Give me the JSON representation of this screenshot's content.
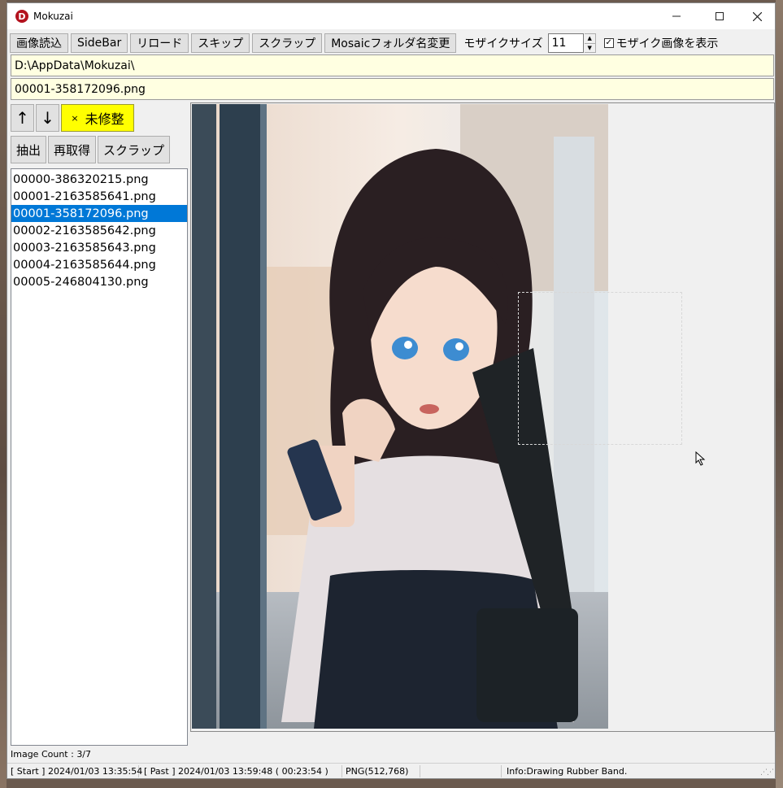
{
  "window": {
    "title": "Mokuzai",
    "icon_letter": "D"
  },
  "toolbar": {
    "load_images": "画像読込",
    "sidebar": "SideBar",
    "reload": "リロード",
    "skip": "スキップ",
    "scrap": "スクラップ",
    "rename_mosaic_folder": "Mosaicフォルダ名変更",
    "mosaic_size_label": "モザイクサイズ",
    "mosaic_size_value": "11",
    "show_mosaic_checked": "☑",
    "show_mosaic_label": "モザイク画像を表示"
  },
  "folder_path": "D:\\AppData\\Mokuzai\\",
  "current_file": "00001-358172096.png",
  "sidebar": {
    "up": "↑",
    "down": "↓",
    "status_mark": "×",
    "status_label": "未修整",
    "extract": "抽出",
    "refetch": "再取得",
    "scrap": "スクラップ",
    "files": [
      "00000-386320215.png",
      "00001-2163585641.png",
      "00001-358172096.png",
      "00002-2163585642.png",
      "00003-2163585643.png",
      "00004-2163585644.png",
      "00005-246804130.png"
    ],
    "selected_index": 2
  },
  "image_count": "Image Count : 3/7",
  "status": {
    "start": "[ Start ] 2024/01/03 13:35:54",
    "past": "[ Past ] 2024/01/03 13:59:48 ( 00:23:54 )",
    "format": "PNG(512,768)",
    "empty": "",
    "info": "Info:Drawing Rubber Band."
  },
  "colors": {
    "selection": "#0078d7",
    "status_button": "#ffff00",
    "path_background": "#ffffe1"
  }
}
